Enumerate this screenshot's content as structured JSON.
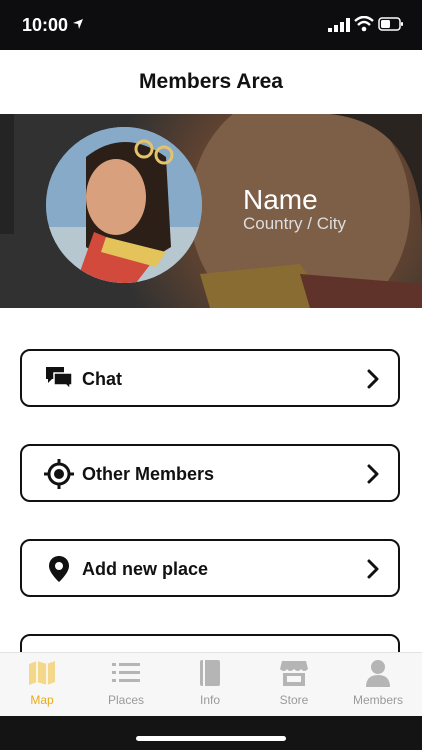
{
  "status_bar": {
    "time": "10:00"
  },
  "header": {
    "title": "Members Area"
  },
  "profile": {
    "name": "Name",
    "location": "Country / City"
  },
  "menu": {
    "items": [
      {
        "label": "Chat",
        "icon": "chat-icon"
      },
      {
        "label": "Other Members",
        "icon": "target-icon"
      },
      {
        "label": "Add new place",
        "icon": "map-pin-icon"
      },
      {
        "label": "",
        "icon": "gift-icon"
      }
    ]
  },
  "tabbar": {
    "active": "Map",
    "accent_color": "#e8ac18",
    "inactive_color": "#9a9a9a",
    "tabs": [
      {
        "label": "Map",
        "icon": "map-icon"
      },
      {
        "label": "Places",
        "icon": "list-icon"
      },
      {
        "label": "Info",
        "icon": "book-icon"
      },
      {
        "label": "Store",
        "icon": "store-icon"
      },
      {
        "label": "Members",
        "icon": "person-icon"
      }
    ]
  }
}
